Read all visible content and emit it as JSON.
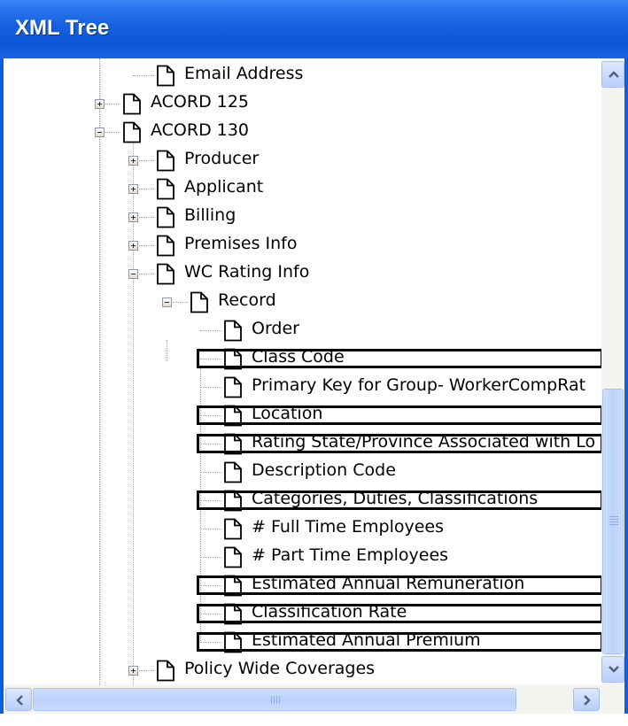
{
  "window": {
    "title": "XML Tree"
  },
  "tree": {
    "items": [
      {
        "label": "Email Address",
        "level": 1,
        "expander": "none",
        "highlighted": false
      },
      {
        "label": "ACORD 125",
        "level": 0,
        "expander": "plus",
        "highlighted": false
      },
      {
        "label": "ACORD 130",
        "level": 0,
        "expander": "minus",
        "highlighted": false
      },
      {
        "label": "Producer",
        "level": 1,
        "expander": "plus",
        "highlighted": false
      },
      {
        "label": "Applicant",
        "level": 1,
        "expander": "plus",
        "highlighted": false
      },
      {
        "label": "Billing",
        "level": 1,
        "expander": "plus",
        "highlighted": false
      },
      {
        "label": "Premises Info",
        "level": 1,
        "expander": "plus",
        "highlighted": false
      },
      {
        "label": "WC Rating Info",
        "level": 1,
        "expander": "minus",
        "highlighted": false
      },
      {
        "label": "Record",
        "level": 2,
        "expander": "minus",
        "highlighted": false
      },
      {
        "label": "Order",
        "level": 3,
        "expander": "none",
        "highlighted": false
      },
      {
        "label": "Class Code",
        "level": 3,
        "expander": "none",
        "highlighted": true
      },
      {
        "label": "Primary Key for Group- WorkerCompRat",
        "level": 3,
        "expander": "none",
        "highlighted": false
      },
      {
        "label": "Location",
        "level": 3,
        "expander": "none",
        "highlighted": true
      },
      {
        "label": "Rating State/Province Associated with Lo",
        "level": 3,
        "expander": "none",
        "highlighted": true
      },
      {
        "label": "Description Code",
        "level": 3,
        "expander": "none",
        "highlighted": false
      },
      {
        "label": "Categories, Duties, Classifications",
        "level": 3,
        "expander": "none",
        "highlighted": true
      },
      {
        "label": "# Full Time Employees",
        "level": 3,
        "expander": "none",
        "highlighted": false
      },
      {
        "label": "# Part Time Employees",
        "level": 3,
        "expander": "none",
        "highlighted": false
      },
      {
        "label": "Estimated Annual Remuneration",
        "level": 3,
        "expander": "none",
        "highlighted": true
      },
      {
        "label": "Classification Rate",
        "level": 3,
        "expander": "none",
        "highlighted": true
      },
      {
        "label": "Estimated Annual Premium",
        "level": 3,
        "expander": "none",
        "highlighted": true
      },
      {
        "label": "Policy Wide Coverages",
        "level": 1,
        "expander": "plus",
        "highlighted": false
      },
      {
        "label": "",
        "level": 1,
        "expander": "none",
        "highlighted": false
      }
    ]
  },
  "icons": {
    "node": "document-icon",
    "expand": "plus-box-icon",
    "collapse": "minus-box-icon",
    "scroll_up": "arrow-up-icon",
    "scroll_down": "arrow-down-icon",
    "scroll_left": "arrow-left-icon",
    "scroll_right": "arrow-right-icon"
  },
  "colors": {
    "titlebar": "#0d57d8",
    "title_text": "#ffffff",
    "highlight_border": "#000000",
    "scrollbar_button": "#c3d6fb"
  }
}
